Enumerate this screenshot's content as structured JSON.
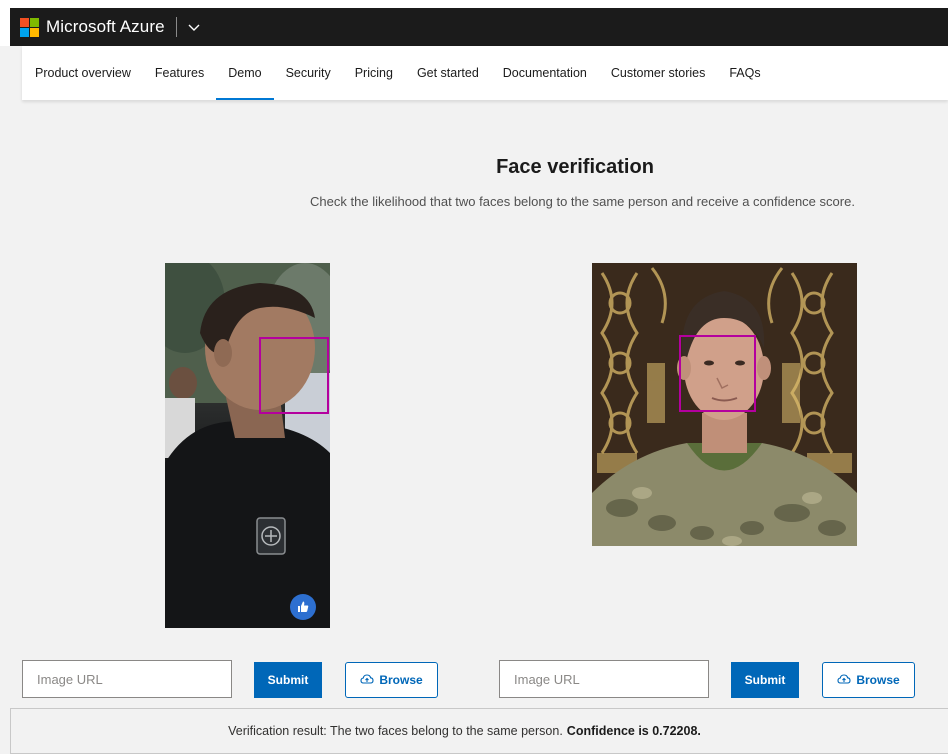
{
  "header": {
    "brand": "Microsoft Azure",
    "logo_colors": [
      "#f25022",
      "#7fba00",
      "#00a4ef",
      "#ffb900"
    ]
  },
  "nav": {
    "items": [
      {
        "label": "Product overview",
        "active": false
      },
      {
        "label": "Features",
        "active": false
      },
      {
        "label": "Demo",
        "active": true
      },
      {
        "label": "Security",
        "active": false
      },
      {
        "label": "Pricing",
        "active": false
      },
      {
        "label": "Get started",
        "active": false
      },
      {
        "label": "Documentation",
        "active": false
      },
      {
        "label": "Customer stories",
        "active": false
      },
      {
        "label": "FAQs",
        "active": false
      }
    ]
  },
  "main": {
    "title": "Face verification",
    "subtitle": "Check the likelihood that two faces belong to the same person and receive a confidence score."
  },
  "left_panel": {
    "url_placeholder": "Image URL",
    "submit_label": "Submit",
    "browse_label": "Browse"
  },
  "right_panel": {
    "url_placeholder": "Image URL",
    "submit_label": "Submit",
    "browse_label": "Browse"
  },
  "result": {
    "text": "Verification result: The two faces belong to the same person.",
    "confidence": "Confidence is 0.72208."
  },
  "colors": {
    "accent": "#0067b8",
    "face_box": "#b4009e"
  },
  "icons": {
    "browse": "upload-cloud-icon",
    "chevron": "chevron-down-icon",
    "like": "thumbs-up-icon"
  }
}
